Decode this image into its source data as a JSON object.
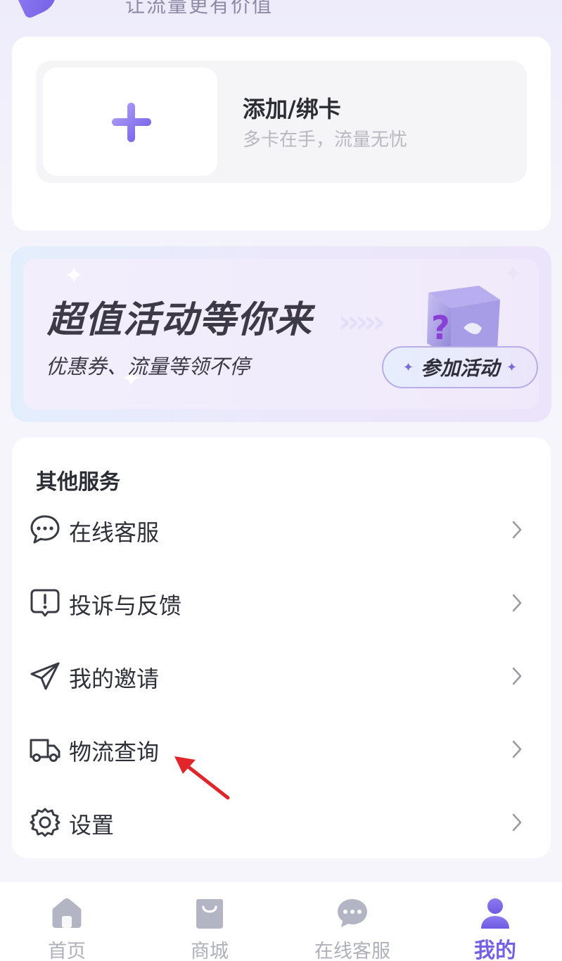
{
  "header": {
    "slogan": "让流量更有价值"
  },
  "card_section": {
    "title": "添加/绑卡",
    "subtitle": "多卡在手，流量无忧"
  },
  "promo": {
    "title": "超值活动等你来",
    "subtitle": "优惠券、流量等领不停",
    "button_label": "参加活动"
  },
  "services": {
    "title": "其他服务",
    "items": [
      {
        "label": "在线客服",
        "icon": "chat-icon"
      },
      {
        "label": "投诉与反馈",
        "icon": "feedback-icon"
      },
      {
        "label": "我的邀请",
        "icon": "send-icon"
      },
      {
        "label": "物流查询",
        "icon": "truck-icon"
      },
      {
        "label": "设置",
        "icon": "gear-icon"
      }
    ]
  },
  "tabbar": {
    "tabs": [
      {
        "label": "首页",
        "icon": "home-icon",
        "active": false
      },
      {
        "label": "商城",
        "icon": "shopping-bag-icon",
        "active": false
      },
      {
        "label": "在线客服",
        "icon": "chat-bubble-icon",
        "active": false
      },
      {
        "label": "我的",
        "icon": "user-icon",
        "active": true
      }
    ]
  },
  "colors": {
    "accent": "#7461e3",
    "inactive_tab": "#b0b0ba",
    "annotation_arrow": "#e0262b"
  }
}
